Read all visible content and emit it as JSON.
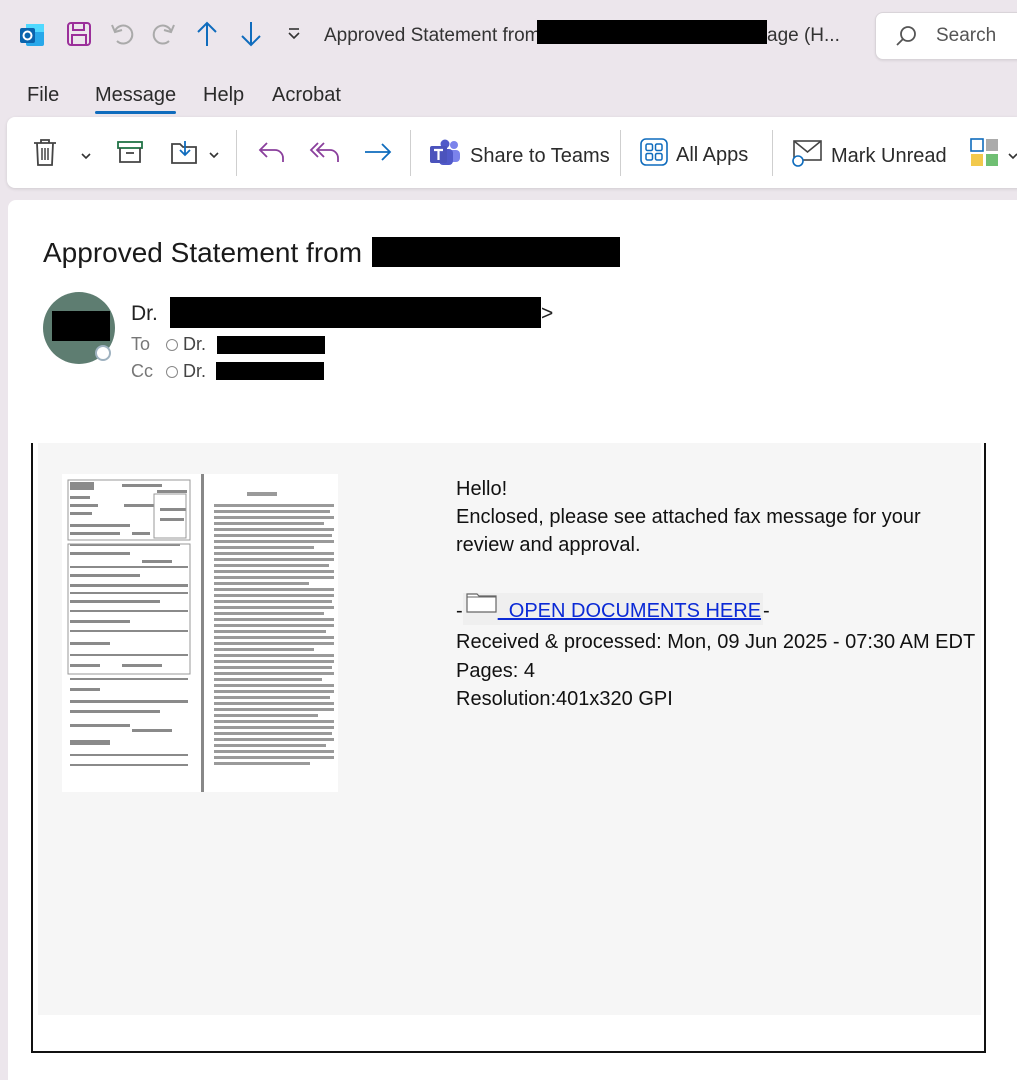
{
  "titlebar": {
    "title_visible": "Approved Statement from",
    "title_tail": "age (H...",
    "search_label": "Search"
  },
  "menu": {
    "tabs": [
      {
        "label": "File"
      },
      {
        "label": "Message"
      },
      {
        "label": "Help"
      },
      {
        "label": "Acrobat"
      }
    ]
  },
  "ribbon": {
    "share_teams": "Share to Teams",
    "all_apps": "All Apps",
    "mark_unread": "Mark Unread"
  },
  "header": {
    "subject": "Approved Statement from",
    "sender_prefix": "Dr. ",
    "sender_suffix": ">",
    "to_label": "To",
    "to_value": "Dr. ",
    "cc_label": "Cc",
    "cc_value": "Dr. "
  },
  "body": {
    "greeting": "Hello!",
    "line1": "Enclosed, please see attached fax message for your",
    "line2": "review and approval.",
    "dash_before": "-",
    "link_text": "  OPEN DOCUMENTS HERE",
    "dash_after": "-",
    "received": "Received & processed: Mon, 09 Jun 2025 - 07:30 AM EDT",
    "pages": "Pages: 4",
    "resolution": "Resolution:401x320 GPI"
  },
  "colors": {
    "accent": "#0f6cbd",
    "avatar": "#5e7d71",
    "link": "#0b2ad6"
  }
}
